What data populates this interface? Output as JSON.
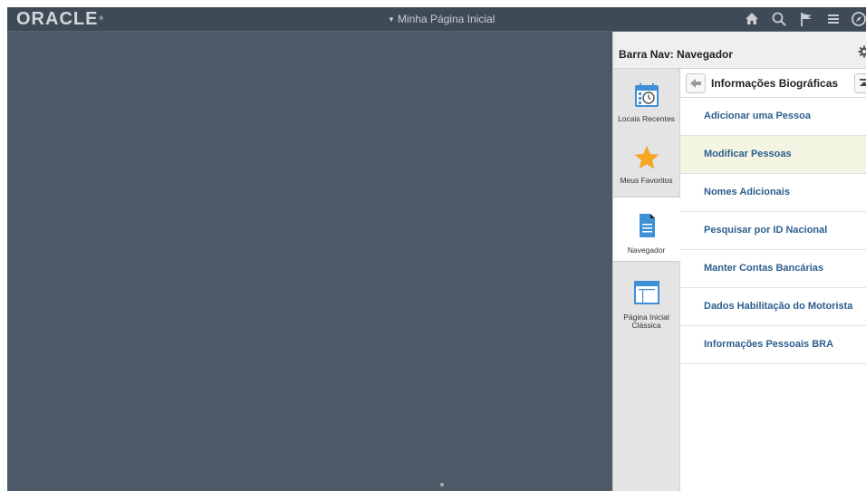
{
  "header": {
    "logo": "ORACLE",
    "logo_tm": "®",
    "page_title": "Minha Página Inicial",
    "icons": [
      "home-icon",
      "search-icon",
      "flag-icon",
      "menu-icon",
      "navbar-icon"
    ]
  },
  "nav_panel": {
    "title": "Barra Nav: Navegador",
    "tabs": [
      {
        "label": "Locais Recentes",
        "icon": "recent-calendar-icon",
        "active": false
      },
      {
        "label": "Meus Favoritos",
        "icon": "star-icon",
        "active": false
      },
      {
        "label": "Navegador",
        "icon": "document-icon",
        "active": true
      },
      {
        "label": "Página Inicial Clássica",
        "icon": "classic-homepage-icon",
        "active": false
      }
    ],
    "folder": {
      "title": "Informações Biográficas"
    },
    "items": [
      {
        "label": "Adicionar uma Pessoa",
        "highlight": false
      },
      {
        "label": "Modificar Pessoas",
        "highlight": true
      },
      {
        "label": "Nomes Adicionais",
        "highlight": false
      },
      {
        "label": "Pesquisar por ID Nacional",
        "highlight": false
      },
      {
        "label": "Manter Contas Bancárias",
        "highlight": false
      },
      {
        "label": "Dados Habilitação do Motorista",
        "highlight": false
      },
      {
        "label": "Informações Pessoais BRA",
        "highlight": false
      }
    ]
  },
  "colors": {
    "banner": "#3e4b57",
    "main": "#4d5966",
    "link": "#2d5e8e",
    "highlight": "#f4f4e3",
    "star": "#f5a623",
    "doc": "#3d8fd6"
  }
}
